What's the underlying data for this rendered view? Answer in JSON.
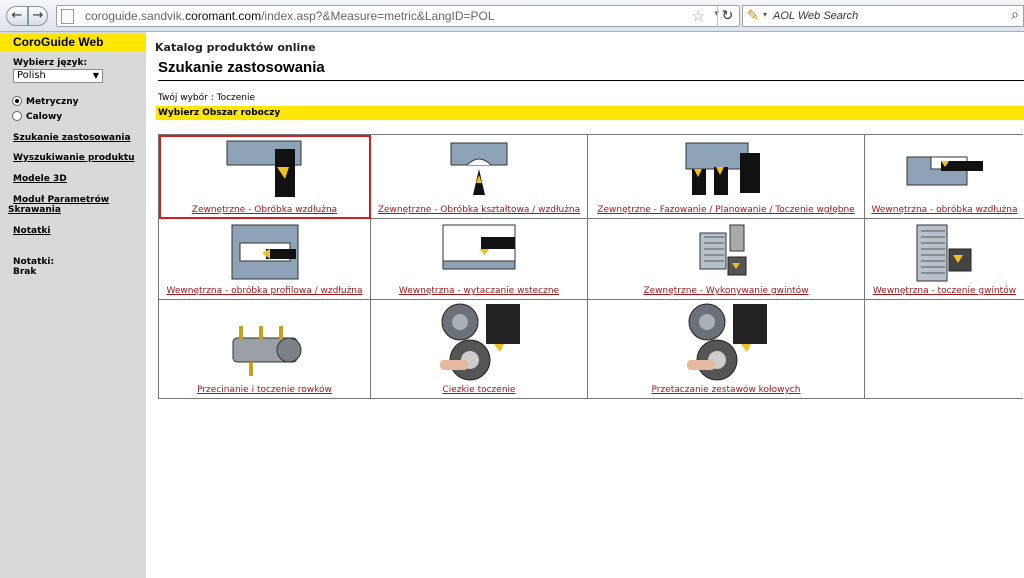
{
  "browser": {
    "back_icon": "arrow-left-icon",
    "forward_icon": "arrow-right-icon",
    "url_prefix": "coroguide.sandvik.",
    "url_domain": "coromant.com",
    "url_suffix": "/index.asp?&Measure=metric&LangID=POL",
    "search_placeholder": "AOL Web Search"
  },
  "sidebar": {
    "title": "CoroGuide Web",
    "language_label": "Wybierz język:",
    "language_value": "Polish",
    "units": [
      {
        "label": "Metryczny",
        "selected": true
      },
      {
        "label": "Calowy",
        "selected": false
      }
    ],
    "links": [
      "Szukanie zastosowania",
      "Wyszukiwanie produktu",
      "Modele 3D",
      "Moduł Parametrów",
      "Skrawania",
      "Notatki"
    ],
    "notes_label": "Notatki:",
    "notes_value": "Brak"
  },
  "main": {
    "catalog": "Katalog produktów online",
    "title": "Szukanie zastosowania",
    "choice": "Twój wybór : Toczenie",
    "bar": "Wybierz Obszar roboczy",
    "cells": [
      "Zewnętrzne - Obróbka wzdłużna",
      "Zewnętrzne - Obróbka kształtowa / wzdłużna",
      "Zewnętrzne - Fazowanie / Planowanie / Toczenie wgłębne",
      "Wewnętrzna - obróbka wzdłużna",
      "Wewnętrzna - obróbka profilowa / wzdłużna",
      "Wewnętrzna - wytaczanie wsteczne",
      "Zewnętrzne - Wykonywanie gwintów",
      "Wewnętrzna - toczenie gwintów",
      "Przecinanie i toczenie rowków",
      "Ciezkie toczenie",
      "Przetaczanie zestawów kołowych"
    ]
  },
  "colors": {
    "yellow": "#ffe600",
    "sidebar_bg": "#d9d9d9",
    "link_red": "#a4161a",
    "selection_red": "#d21f1f"
  }
}
